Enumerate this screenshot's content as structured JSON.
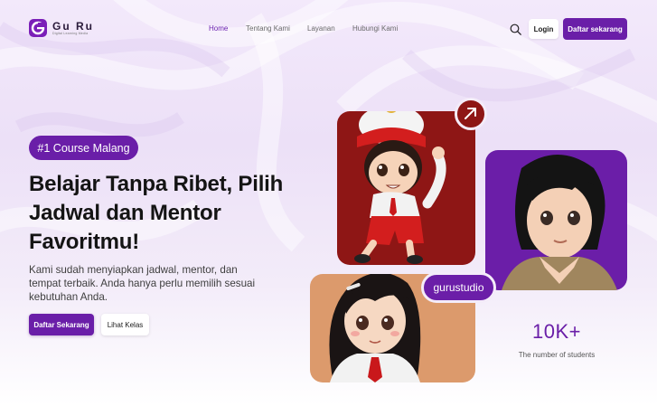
{
  "brand": {
    "name": "Gu Ru",
    "tagline": "Digital Learning Media",
    "accent": "#6a1ea8"
  },
  "nav": {
    "items": [
      {
        "label": "Home",
        "active": true
      },
      {
        "label": "Tentang Kami",
        "active": false
      },
      {
        "label": "Layanan",
        "active": false
      },
      {
        "label": "Hubungi Kami",
        "active": false
      }
    ],
    "search_icon": "search-icon",
    "login_label": "Login",
    "register_label": "Daftar sekarang"
  },
  "hero": {
    "badge": "#1 Course Malang",
    "title_lines": [
      "Belajar Tanpa Ribet, Pilih",
      "Jadwal dan Mentor",
      "Favoritmu!"
    ],
    "description_lines": [
      "Kami sudah menyiapkan jadwal, mentor, dan",
      "tempat terbaik. Anda hanya perlu memilih sesuai",
      "kebutuhan Anda."
    ],
    "primary_button": "Daftar Sekarang",
    "secondary_button": "Lihat Kelas"
  },
  "showcase": {
    "studio_label": "gurustudio",
    "arrow_icon": "arrow-up-right-icon",
    "stat_value": "10K+",
    "stat_label": "The number of students",
    "card_colors": [
      "#8e1615",
      "#6b1ea8",
      "#dc9a6c"
    ]
  }
}
